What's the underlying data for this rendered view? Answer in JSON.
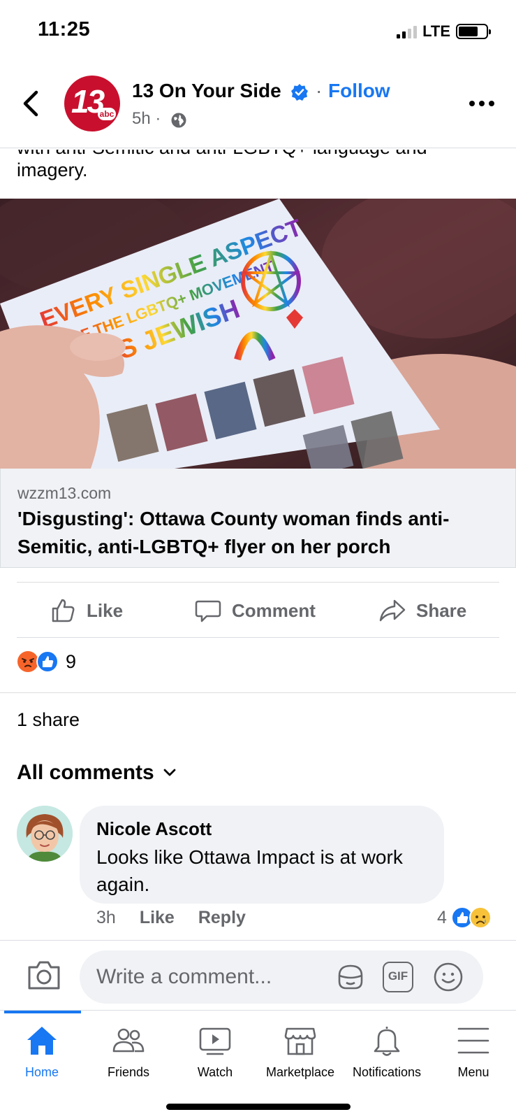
{
  "status_bar": {
    "time": "11:25",
    "network": "LTE"
  },
  "header": {
    "page_name": "13 On Your Side",
    "separator": "·",
    "follow_label": "Follow",
    "post_time": "5h ·",
    "logo_number": "13",
    "logo_badge": "abc"
  },
  "post": {
    "text_cut": "with anti-Semitic and anti-LGBTQ+ language and",
    "text_visible": "imagery.",
    "image_text_lines": [
      "EVERY SINGLE ASPECT",
      "OF THE LGBTQ+ MOVEMENT",
      "IS JEWISH"
    ]
  },
  "link_preview": {
    "domain": "wzzm13.com",
    "title": "'Disgusting': Ottawa County woman finds anti-Semitic, anti-LGBTQ+ flyer on her porch"
  },
  "actions": {
    "like": "Like",
    "comment": "Comment",
    "share": "Share"
  },
  "reactions": {
    "count": "9"
  },
  "shares": "1 share",
  "comments_header": "All comments",
  "comment": {
    "author": "Nicole Ascott",
    "text": "Looks like Ottawa Impact is at work again.",
    "time": "3h",
    "like": "Like",
    "reply": "Reply",
    "reaction_count": "4"
  },
  "composer": {
    "placeholder": "Write a comment...",
    "gif": "GIF"
  },
  "tabs": [
    {
      "label": "Home"
    },
    {
      "label": "Friends"
    },
    {
      "label": "Watch"
    },
    {
      "label": "Marketplace"
    },
    {
      "label": "Notifications"
    },
    {
      "label": "Menu"
    }
  ],
  "colors": {
    "accent": "#1877f2",
    "brand_logo": "#c8102e",
    "muted_text": "#65676b",
    "surface": "#f0f2f5"
  }
}
